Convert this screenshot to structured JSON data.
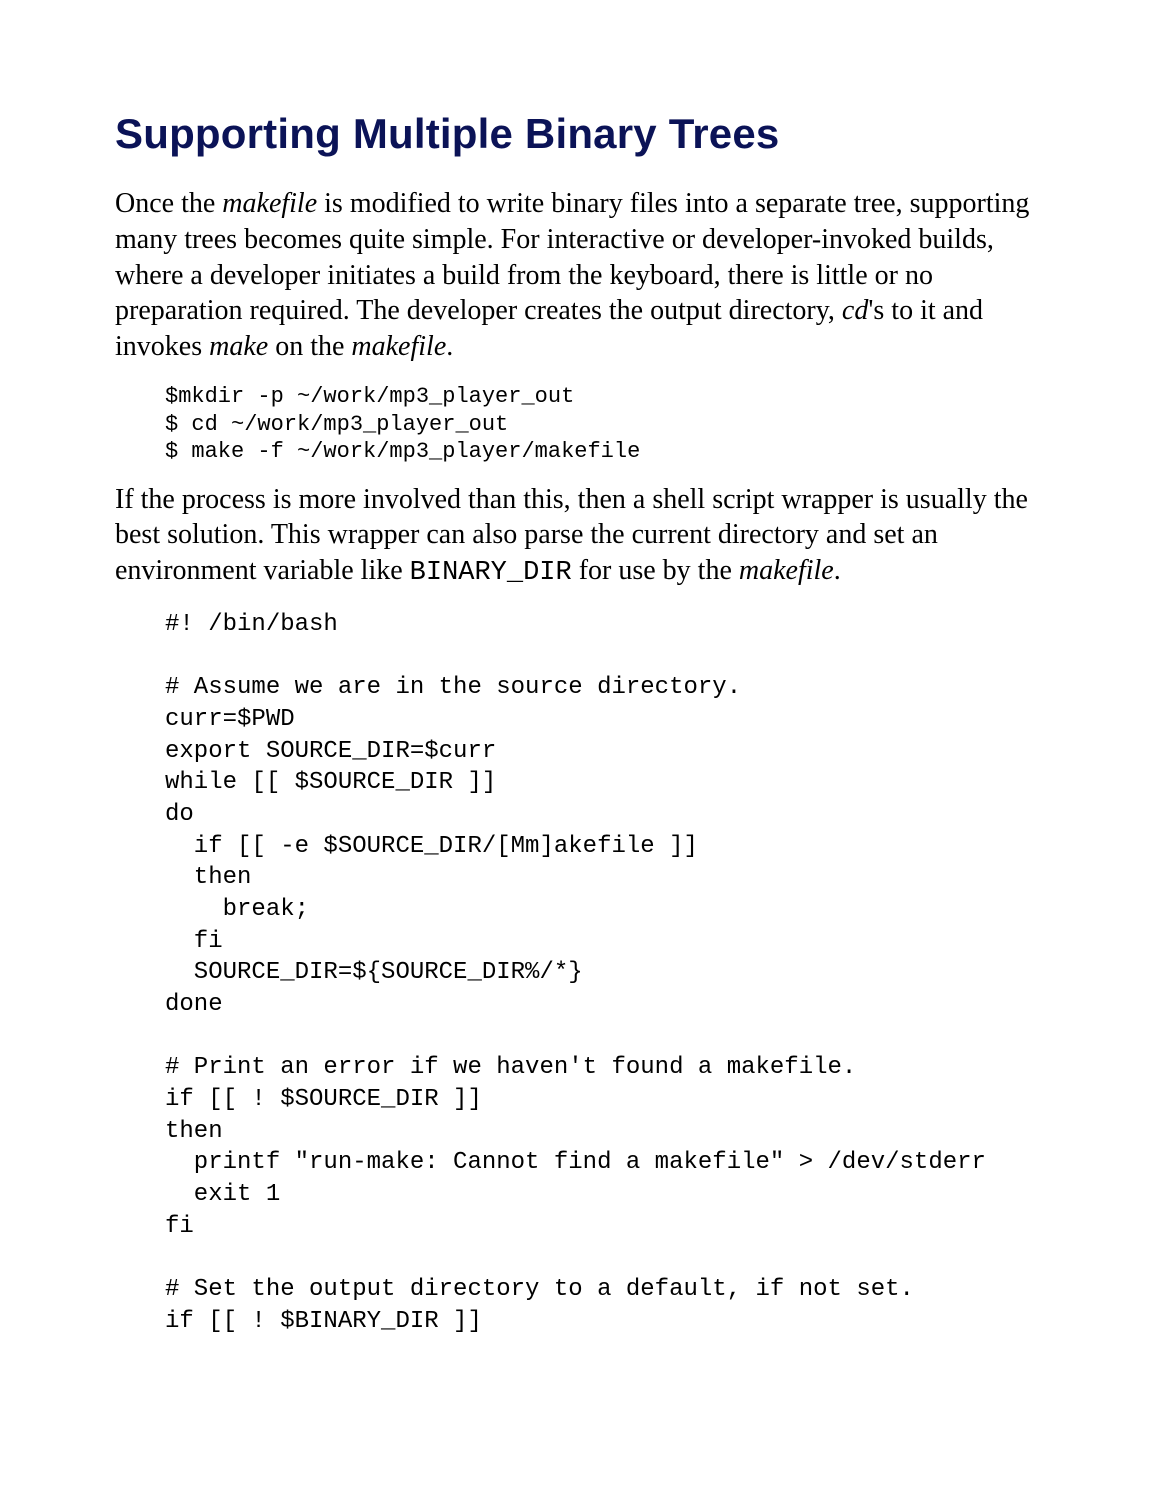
{
  "title": "Supporting Multiple Binary Trees",
  "para1": {
    "a": "Once the ",
    "b": "makefile",
    "c": " is modified to write binary files into a separate tree, supporting many trees becomes quite simple. For interactive or developer-invoked builds, where a developer initiates a build from the keyboard, there is little or no preparation required. The developer creates the output directory, ",
    "d": "cd",
    "e": "'s to it and invokes ",
    "f": "make",
    "g": " on the ",
    "h": "makefile",
    "i": "."
  },
  "code1": "$mkdir -p ~/work/mp3_player_out\n$ cd ~/work/mp3_player_out\n$ make -f ~/work/mp3_player/makefile",
  "para2": {
    "a": "If the process is more involved than this, then a shell script wrapper is usually the best solution. This wrapper can also parse the current directory and set an environment variable like ",
    "b": "BINARY_DIR",
    "c": " for use by the ",
    "d": "makefile",
    "e": "."
  },
  "code2": "#! /bin/bash\n\n# Assume we are in the source directory.\ncurr=$PWD\nexport SOURCE_DIR=$curr\nwhile [[ $SOURCE_DIR ]]\ndo\n  if [[ -e $SOURCE_DIR/[Mm]akefile ]]\n  then\n    break;\n  fi\n  SOURCE_DIR=${SOURCE_DIR%/*}\ndone\n\n# Print an error if we haven't found a makefile.\nif [[ ! $SOURCE_DIR ]]\nthen\n  printf \"run-make: Cannot find a makefile\" > /dev/stderr\n  exit 1\nfi\n\n# Set the output directory to a default, if not set.\nif [[ ! $BINARY_DIR ]]"
}
